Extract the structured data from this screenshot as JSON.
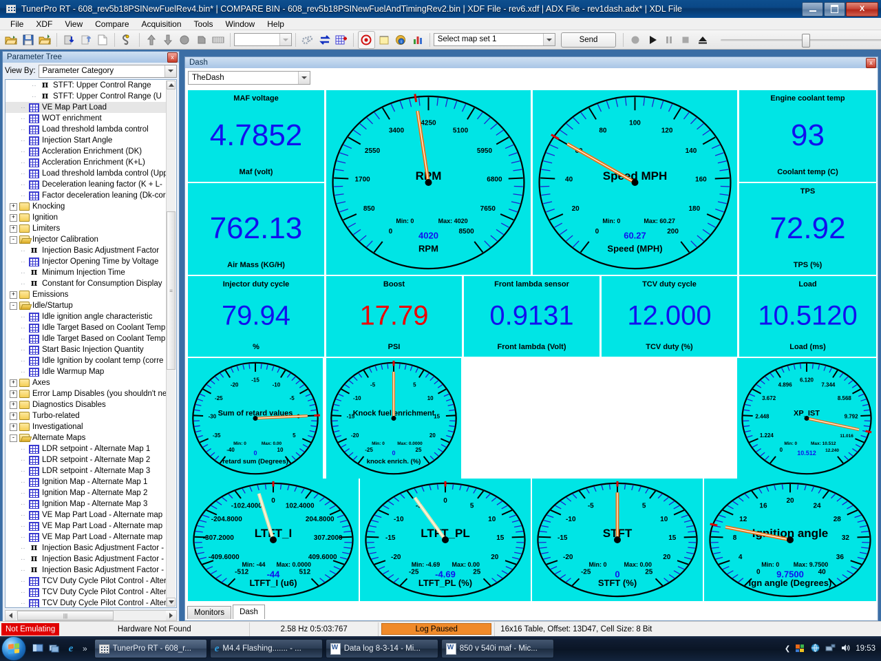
{
  "window": {
    "title": "TunerPro RT - 608_rev5b18PSINewFuelRev4.bin* | COMPARE BIN - 608_rev5b18PSINewFuelAndTimingRev2.bin | XDF File - rev6.xdf | ADX File - rev1dash.adx* | XDL File",
    "minimize_label": "–",
    "maximize_label": "❐",
    "close_label": "X"
  },
  "menu": {
    "items": [
      "File",
      "XDF",
      "View",
      "Compare",
      "Acquisition",
      "Tools",
      "Window",
      "Help"
    ]
  },
  "toolbar": {
    "mapset_value": "Select map set 1",
    "send_label": "Send",
    "icons": [
      "open-folder-icon",
      "save-disk-icon",
      "open-compare-icon",
      "upload-bin-icon",
      "download-bin-icon",
      "new-file-icon",
      "acquisition-icon",
      "upload-arrow-icon",
      "download-arrow-icon",
      "flash-read-icon",
      "flash-write-icon",
      "hex-editor-icon",
      "gears-icon",
      "swap-arrows-icon",
      "table-compare-icon",
      "emulation-icon",
      "notes-icon",
      "info-icon",
      "chart-icon",
      "record-icon",
      "play-icon",
      "pause-icon",
      "stop-icon",
      "eject-icon"
    ]
  },
  "parameter_tree": {
    "panel_title": "Parameter Tree",
    "close_label": "x",
    "view_by_label": "View By:",
    "view_by_value": "Parameter Category",
    "items": [
      {
        "label": "STFT: Upper Control Range",
        "icon": "pi-icon",
        "indent": 3,
        "kind": "param"
      },
      {
        "label": "STFT: Upper Control Range (U",
        "icon": "pi-icon",
        "indent": 3,
        "kind": "param"
      },
      {
        "label": "VE Map Part Load",
        "icon": "table-icon",
        "indent": 2,
        "kind": "table",
        "selected": true
      },
      {
        "label": "WOT enrichment",
        "icon": "table-icon",
        "indent": 2,
        "kind": "table"
      },
      {
        "label": "Load threshold lambda control",
        "icon": "table-icon",
        "indent": 2,
        "kind": "table"
      },
      {
        "label": "Injection Start Angle",
        "icon": "table-icon",
        "indent": 2,
        "kind": "table"
      },
      {
        "label": "Accleration Enrichment (DK)",
        "icon": "table-icon",
        "indent": 2,
        "kind": "table"
      },
      {
        "label": "Accleration Enrichment (K+L)",
        "icon": "table-icon",
        "indent": 2,
        "kind": "table"
      },
      {
        "label": "Load threshold lambda control (Upp",
        "icon": "table-icon",
        "indent": 2,
        "kind": "table"
      },
      {
        "label": "Deceleration leaning factor (K + L-",
        "icon": "table-icon",
        "indent": 2,
        "kind": "table"
      },
      {
        "label": "Factor deceleration leaning (Dk-cor",
        "icon": "table-icon",
        "indent": 2,
        "kind": "table"
      },
      {
        "label": "Knocking",
        "icon": "folder-icon",
        "indent": 1,
        "kind": "folder",
        "expander": "+"
      },
      {
        "label": "Ignition",
        "icon": "folder-icon",
        "indent": 1,
        "kind": "folder",
        "expander": "+"
      },
      {
        "label": "Limiters",
        "icon": "folder-icon",
        "indent": 1,
        "kind": "folder",
        "expander": "+"
      },
      {
        "label": "Injector Calibration",
        "icon": "folder-open-icon",
        "indent": 1,
        "kind": "folder-open",
        "expander": "-"
      },
      {
        "label": "Injection Basic Adjustment Factor",
        "icon": "pi-icon",
        "indent": 2,
        "kind": "param"
      },
      {
        "label": "Injector Opening Time by Voltage",
        "icon": "table-icon",
        "indent": 2,
        "kind": "table"
      },
      {
        "label": "Minimum Injection Time",
        "icon": "pi-icon",
        "indent": 2,
        "kind": "param"
      },
      {
        "label": "Constant for Consumption Display",
        "icon": "pi-icon",
        "indent": 2,
        "kind": "param"
      },
      {
        "label": "Emissions",
        "icon": "folder-icon",
        "indent": 1,
        "kind": "folder",
        "expander": "+"
      },
      {
        "label": "Idle/Startup",
        "icon": "folder-open-icon",
        "indent": 1,
        "kind": "folder-open",
        "expander": "-"
      },
      {
        "label": "Idle ignition angle characteristic",
        "icon": "table-icon",
        "indent": 2,
        "kind": "table"
      },
      {
        "label": "Idle Target Based on Coolant Temp",
        "icon": "table-icon",
        "indent": 2,
        "kind": "table"
      },
      {
        "label": "Idle Target Based on Coolant Temp",
        "icon": "table-icon",
        "indent": 2,
        "kind": "table"
      },
      {
        "label": "Start Basic Injection Quantity",
        "icon": "table-icon",
        "indent": 2,
        "kind": "table"
      },
      {
        "label": "Idle Ignition by coolant temp (corre",
        "icon": "table-icon",
        "indent": 2,
        "kind": "table"
      },
      {
        "label": "Idle Warmup Map",
        "icon": "table-icon",
        "indent": 2,
        "kind": "table"
      },
      {
        "label": "Axes",
        "icon": "folder-icon",
        "indent": 1,
        "kind": "folder",
        "expander": "+"
      },
      {
        "label": "Error Lamp Disables (you shouldn't nee",
        "icon": "folder-icon",
        "indent": 1,
        "kind": "folder",
        "expander": "+"
      },
      {
        "label": "Diagnostics Disables",
        "icon": "folder-icon",
        "indent": 1,
        "kind": "folder",
        "expander": "+"
      },
      {
        "label": "Turbo-related",
        "icon": "folder-icon",
        "indent": 1,
        "kind": "folder",
        "expander": "+"
      },
      {
        "label": "Investigational",
        "icon": "folder-icon",
        "indent": 1,
        "kind": "folder",
        "expander": "+"
      },
      {
        "label": "Alternate Maps",
        "icon": "folder-open-icon",
        "indent": 1,
        "kind": "folder-open",
        "expander": "-"
      },
      {
        "label": "LDR setpoint - Alternate Map 1",
        "icon": "table-icon",
        "indent": 2,
        "kind": "table"
      },
      {
        "label": "LDR setpoint - Alternate Map 2",
        "icon": "table-icon",
        "indent": 2,
        "kind": "table"
      },
      {
        "label": "LDR setpoint - Alternate Map 3",
        "icon": "table-icon",
        "indent": 2,
        "kind": "table"
      },
      {
        "label": "Ignition Map - Alternate Map 1",
        "icon": "table-icon",
        "indent": 2,
        "kind": "table"
      },
      {
        "label": "Ignition Map - Alternate Map 2",
        "icon": "table-icon",
        "indent": 2,
        "kind": "table"
      },
      {
        "label": "Ignition Map - Alternate Map 3",
        "icon": "table-icon",
        "indent": 2,
        "kind": "table"
      },
      {
        "label": "VE Map Part Load - Alternate map",
        "icon": "table-icon",
        "indent": 2,
        "kind": "table"
      },
      {
        "label": "VE Map Part Load - Alternate map",
        "icon": "table-icon",
        "indent": 2,
        "kind": "table"
      },
      {
        "label": "VE Map Part Load - Alternate map",
        "icon": "table-icon",
        "indent": 2,
        "kind": "table"
      },
      {
        "label": "Injection Basic Adjustment Factor -",
        "icon": "pi-icon",
        "indent": 2,
        "kind": "param"
      },
      {
        "label": "Injection Basic Adjustment Factor -",
        "icon": "pi-icon",
        "indent": 2,
        "kind": "param"
      },
      {
        "label": "Injection Basic Adjustment Factor -",
        "icon": "pi-icon",
        "indent": 2,
        "kind": "param"
      },
      {
        "label": "TCV Duty Cycle Pilot Control - Alter",
        "icon": "table-icon",
        "indent": 2,
        "kind": "table"
      },
      {
        "label": "TCV Duty Cycle Pilot Control - Alter",
        "icon": "table-icon",
        "indent": 2,
        "kind": "table"
      },
      {
        "label": "TCV Duty Cycle Pilot Control - Alter",
        "icon": "table-icon",
        "indent": 2,
        "kind": "table"
      }
    ]
  },
  "dash": {
    "window_title": "Dash",
    "close_label": "x",
    "selector_value": "TheDash",
    "tabs": [
      {
        "label": "Monitors",
        "active": false
      },
      {
        "label": "Dash",
        "active": true
      }
    ],
    "background": "#00e5e5",
    "value_color": "#1111ee",
    "alert_color": "#ee0000"
  },
  "chart_data": [
    {
      "type": "numeric-readout",
      "title": "MAF voltage",
      "value": "4.7852",
      "unit_label": "Maf (volt)",
      "color": "#1111ee"
    },
    {
      "type": "numeric-readout",
      "title": "",
      "value": "762.13",
      "unit_label": "Air Mass (KG/H)",
      "color": "#1111ee"
    },
    {
      "type": "gauge",
      "title": "RPM",
      "value": 4020,
      "value_label": "4020",
      "unit_label": "RPM",
      "min": 0,
      "max": 8500,
      "min_label": "Min: 0",
      "max_label": "Max: 4020",
      "ticks": [
        0,
        850,
        1700,
        2550,
        3400,
        4250,
        5100,
        5950,
        6800,
        7650,
        8500
      ],
      "tick_labels": [
        "0",
        "850",
        "1700",
        "2550",
        "3400",
        "4250",
        "5100",
        "5950",
        "6800",
        "7650",
        "8500"
      ],
      "redline_at": 4020,
      "needle_color": "#e8741a"
    },
    {
      "type": "gauge",
      "title": "Speed MPH",
      "value": 60.27,
      "value_label": "60.27",
      "unit_label": "Speed (MPH)",
      "min": 0,
      "max": 200,
      "min_label": "Min: 0",
      "max_label": "Max: 60.27",
      "ticks": [
        0,
        20,
        40,
        60,
        80,
        100,
        120,
        140,
        160,
        180,
        200
      ],
      "tick_labels": [
        "0",
        "20",
        "40",
        "60",
        "80",
        "100",
        "120",
        "140",
        "160",
        "180",
        "200"
      ],
      "redline_at": 60.27,
      "needle_color": "#e8741a"
    },
    {
      "type": "numeric-readout",
      "title": "Engine coolant temp",
      "value": "93",
      "unit_label": "Coolant temp (C)",
      "color": "#1111ee"
    },
    {
      "type": "numeric-readout",
      "title": "TPS",
      "value": "72.92",
      "unit_label": "TPS (%)",
      "color": "#1111ee"
    },
    {
      "type": "numeric-readout",
      "title": "Injector duty cycle",
      "value": "79.94",
      "unit_label": "%",
      "color": "#1111ee"
    },
    {
      "type": "numeric-readout",
      "title": "Boost",
      "value": "17.79",
      "unit_label": "PSI",
      "color": "#ee0000"
    },
    {
      "type": "numeric-readout",
      "title": "Front lambda sensor",
      "value": "0.9131",
      "unit_label": "Front lambda (Volt)",
      "color": "#1111ee"
    },
    {
      "type": "numeric-readout",
      "title": "TCV duty cycle",
      "value": "12.000",
      "unit_label": "TCV duty (%)",
      "color": "#1111ee"
    },
    {
      "type": "numeric-readout",
      "title": "Load",
      "value": "10.5120",
      "unit_label": "Load (ms)",
      "color": "#1111ee"
    },
    {
      "type": "gauge",
      "title": "Sum of retard values",
      "value": 0,
      "value_label": "0",
      "unit_label": "retard sum (Degrees)",
      "min": -40,
      "max": 10,
      "min_label": "Min: 0",
      "max_label": "Max: 0.00",
      "ticks": [
        -40,
        -35,
        -30,
        -25,
        -20,
        -15,
        -10,
        -5,
        0,
        5,
        10
      ],
      "tick_labels": [
        "-40",
        "-35",
        "-30",
        "-25",
        "-20",
        "-15",
        "-10",
        "-5",
        "0",
        "5",
        "10"
      ],
      "redline_at": 0,
      "needle_color": "#e8741a"
    },
    {
      "type": "gauge",
      "title": "Knock fuel enrichment",
      "value": 0,
      "value_label": "0",
      "unit_label": "knock enrich. (%)",
      "min": -25,
      "max": 25,
      "min_label": "Min: 0",
      "max_label": "Max: 0.0000",
      "ticks": [
        -25,
        -20,
        -15,
        -10,
        -5,
        0,
        5,
        10,
        15,
        20,
        25
      ],
      "tick_labels": [
        "-25",
        "-20",
        "-15",
        "-10",
        "-5",
        "0",
        "5",
        "10",
        "15",
        "20",
        "25"
      ],
      "redline_at": 0,
      "needle_color": "#e8741a"
    },
    {
      "type": "gauge",
      "title": "XP_IST",
      "value": 10.512,
      "value_label": "10.512",
      "unit_label": "",
      "min": 0,
      "max": 12.24,
      "min_label": "Min: 0",
      "max_label": "Max: 10.512",
      "ticks": [
        0,
        1.224,
        2.448,
        3.672,
        4.896,
        6.12,
        7.344,
        8.568,
        9.792,
        11.016,
        12.24
      ],
      "tick_labels": [
        "0",
        "1.224",
        "2.448",
        "3.672",
        "4.896",
        "6.120",
        "7.344",
        "8.568",
        "9.792",
        "11.016",
        "12.240"
      ],
      "redline_at": 10.512,
      "needle_color": "#e8741a"
    },
    {
      "type": "gauge",
      "title": "LTFT_I",
      "value": -44,
      "value_label": "-44",
      "unit_label": "LTFT_I (u6)",
      "min": -512,
      "max": 512,
      "min_label": "Min: -44",
      "max_label": "Max: 0.0000",
      "ticks": [
        -512,
        -409.6,
        -307.2,
        -204.8,
        -102.4,
        0,
        102.4,
        204.8,
        307.2,
        409.6,
        512
      ],
      "tick_labels": [
        "-512",
        "-409.6000",
        "-307.2000",
        "-204.8000",
        "-102.4000",
        "0",
        "102.4000",
        "204.8000",
        "307.2000",
        "409.6000",
        "512"
      ],
      "redline_at": 0,
      "needle_color": "#e8e0b0"
    },
    {
      "type": "gauge",
      "title": "LTFT_PL",
      "value": -4.69,
      "value_label": "-4.69",
      "unit_label": "LTFT_PL (%)",
      "min": -25,
      "max": 25,
      "min_label": "Min: -4.69",
      "max_label": "Max: 0.00",
      "ticks": [
        -25,
        -20,
        -15,
        -10,
        -5,
        0,
        5,
        10,
        15,
        20,
        25
      ],
      "tick_labels": [
        "-25",
        "-20",
        "-15",
        "-10",
        "-5",
        "0",
        "5",
        "10",
        "15",
        "20",
        "25"
      ],
      "redline_at": 0,
      "needle_color": "#e8e0b0"
    },
    {
      "type": "gauge",
      "title": "STFT",
      "value": 0,
      "value_label": "0",
      "unit_label": "STFT (%)",
      "min": -25,
      "max": 25,
      "min_label": "Min: 0",
      "max_label": "Max: 0.00",
      "ticks": [
        -25,
        -20,
        -15,
        -10,
        -5,
        0,
        5,
        10,
        15,
        20,
        25
      ],
      "tick_labels": [
        "-25",
        "-20",
        "-15",
        "-10",
        "-5",
        "0",
        "5",
        "10",
        "15",
        "20",
        "25"
      ],
      "redline_at": 0,
      "needle_color": "#e8741a"
    },
    {
      "type": "gauge",
      "title": "Ignition angle",
      "value": 9.75,
      "value_label": "9.7500",
      "unit_label": "Ign angle (Degrees)",
      "min": 0,
      "max": 40,
      "min_label": "Min: 0",
      "max_label": "Max: 9.7500",
      "ticks": [
        0,
        4,
        8,
        12,
        16,
        20,
        24,
        28,
        32,
        36,
        40
      ],
      "tick_labels": [
        "0",
        "4",
        "8",
        "12",
        "16",
        "20",
        "24",
        "28",
        "32",
        "36",
        "40"
      ],
      "redline_at": 9.75,
      "needle_color": "#e8741a"
    }
  ],
  "status_bar": {
    "emulation": "Not Emulating",
    "hardware": "Hardware Not Found",
    "rate": "2.58 Hz  0:5:03:767",
    "log_state": "Log Paused",
    "table_info": "16x16 Table, Offset: 13D47,  Cell Size: 8 Bit"
  },
  "taskbar": {
    "start_label": "start-orb",
    "quick_launch": [
      "show-desktop-icon",
      "switch-window-icon",
      "internet-explorer-icon"
    ],
    "overflow_label": "»",
    "tasks": [
      {
        "label": "TunerPro RT - 608_r...",
        "icon": "tunerpro-icon",
        "active": true
      },
      {
        "label": "M4.4 Flashing....... - ...",
        "icon": "internet-explorer-icon",
        "active": false
      },
      {
        "label": "Data log 8-3-14 - Mi...",
        "icon": "word-doc-icon",
        "active": false
      },
      {
        "label": "850 v 540i maf - Mic...",
        "icon": "word-doc-icon",
        "active": false
      }
    ],
    "tray_icons": [
      "tray-chevron-icon",
      "security-icon",
      "network-globe-icon",
      "network-icon",
      "volume-icon"
    ],
    "clock": "19:53"
  }
}
